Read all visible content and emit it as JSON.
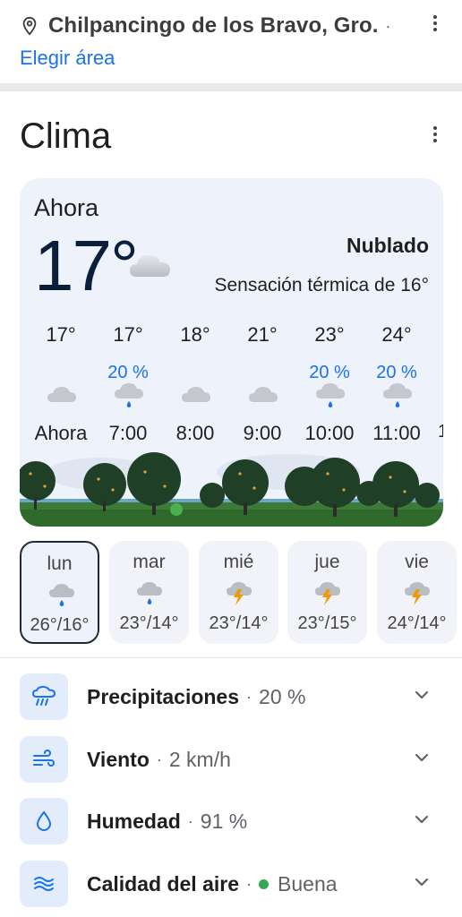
{
  "location": {
    "name": "Chilpancingo de los Bravo, Gro.",
    "separator": "·",
    "change_area": "Elegir área"
  },
  "section_title": "Clima",
  "current": {
    "label": "Ahora",
    "temp": "17°",
    "icon": "cloud-icon",
    "condition": "Nublado",
    "feels_like": "Sensación térmica de 16°"
  },
  "hourly": [
    {
      "temp": "17°",
      "precip": "",
      "icon": "cloud-icon",
      "time": "Ahora"
    },
    {
      "temp": "17°",
      "precip": "20 %",
      "icon": "cloud-rain-icon",
      "time": "7:00"
    },
    {
      "temp": "18°",
      "precip": "",
      "icon": "cloud-icon",
      "time": "8:00"
    },
    {
      "temp": "21°",
      "precip": "",
      "icon": "cloud-icon",
      "time": "9:00"
    },
    {
      "temp": "23°",
      "precip": "20 %",
      "icon": "cloud-rain-icon",
      "time": "10:00"
    },
    {
      "temp": "24°",
      "precip": "20 %",
      "icon": "cloud-rain-icon",
      "time": "11:00"
    }
  ],
  "hourly_more": "1",
  "daily": [
    {
      "day": "lun",
      "icon": "cloud-rain-icon",
      "range": "26°/16°",
      "selected": true
    },
    {
      "day": "mar",
      "icon": "cloud-rain-icon",
      "range": "23°/14°",
      "selected": false
    },
    {
      "day": "mié",
      "icon": "thunderstorm-icon",
      "range": "23°/14°",
      "selected": false
    },
    {
      "day": "jue",
      "icon": "thunderstorm-icon",
      "range": "23°/15°",
      "selected": false
    },
    {
      "day": "vie",
      "icon": "thunderstorm-icon",
      "range": "24°/14°",
      "selected": false
    }
  ],
  "details": {
    "precipitation": {
      "label": "Precipitaciones",
      "value": "20 %",
      "icon": "umbrella-rain-icon"
    },
    "wind": {
      "label": "Viento",
      "value": "2 km/h",
      "icon": "wind-icon"
    },
    "humidity": {
      "label": "Humedad",
      "value": "91 %",
      "icon": "water-drop-icon"
    },
    "air_quality": {
      "label": "Calidad del aire",
      "value": "Buena",
      "icon": "air-waves-icon"
    }
  },
  "separator": "·",
  "colors": {
    "accent": "#1a73e8",
    "card_bg": "#eef2fa",
    "aqi_good": "#34a853"
  }
}
